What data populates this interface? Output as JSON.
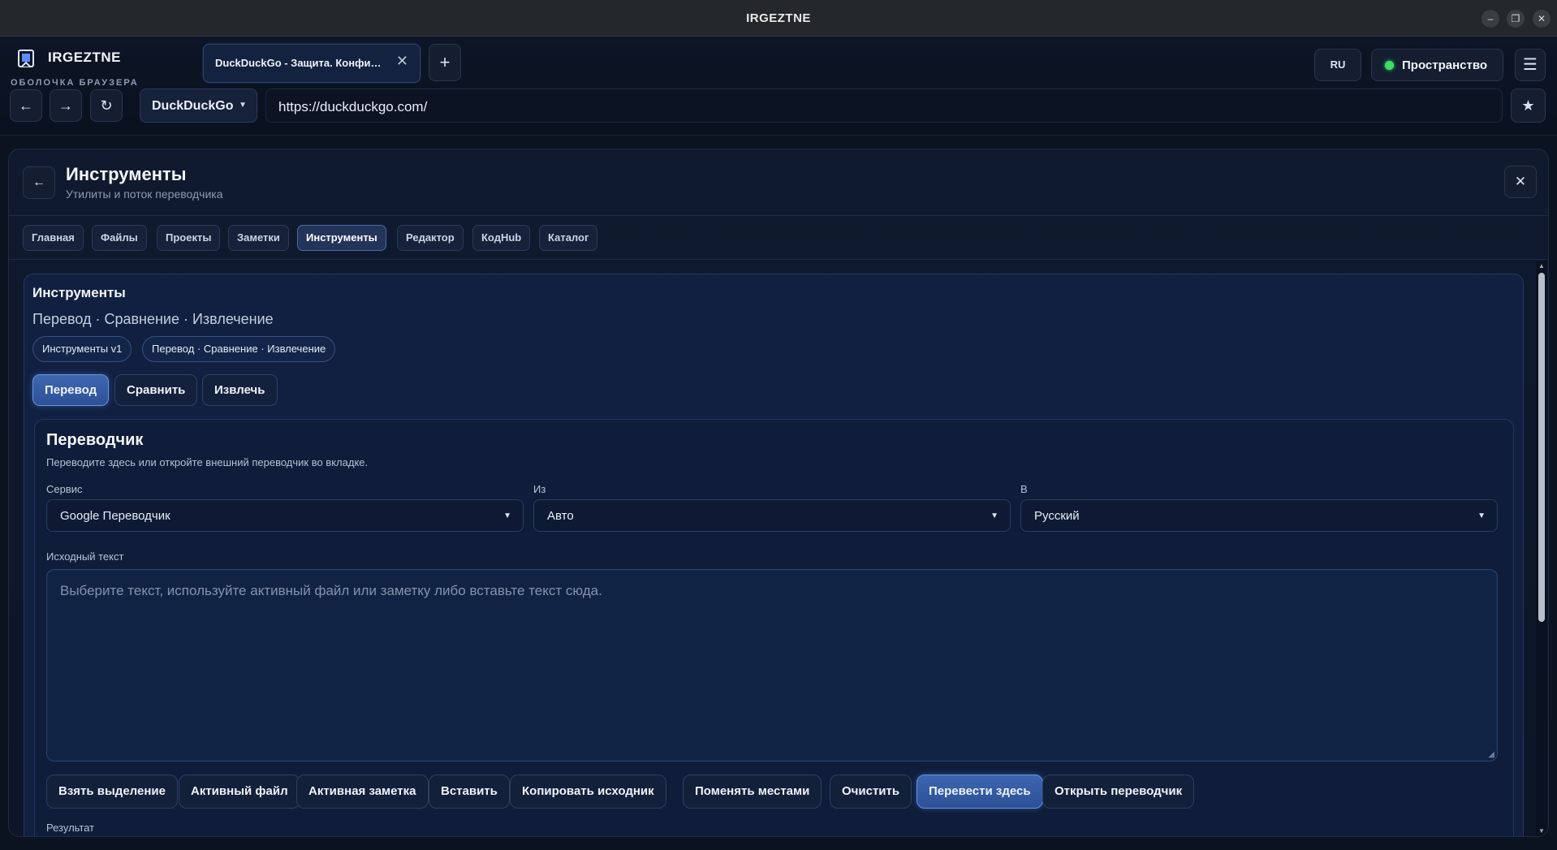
{
  "window": {
    "title": "IRGEZTNE",
    "controls": [
      "–",
      "❐",
      "✕"
    ]
  },
  "brand": {
    "name": "IRGEZTNE",
    "subtitle": "ОБОЛОЧКА БРАУЗЕРА"
  },
  "tabs": [
    {
      "label": "DuckDuckGo - Защита. Конфиденциальность. Мир.",
      "close": "✕"
    }
  ],
  "new_tab": "+",
  "nav": {
    "back": "←",
    "forward": "→",
    "reload": "↻"
  },
  "header_right": {
    "lang": "RU",
    "space_label": "Пространство",
    "space_status_color": "#3ddc6a",
    "menu": "☰"
  },
  "search_engine": {
    "value": "DuckDuckGo",
    "chevron": "▼"
  },
  "address": {
    "url": "https://duckduckgo.com/"
  },
  "bookmark": "★",
  "panel": {
    "back": "←",
    "title": "Инструменты",
    "subtitle": "Утилиты и поток переводчика",
    "close": "✕",
    "tabs": [
      "Главная",
      "Файлы",
      "Проекты",
      "Заметки",
      "Инструменты",
      "Редактор",
      "КодHub",
      "Каталог"
    ],
    "active_tab": "Инструменты"
  },
  "tools": {
    "title": "Инструменты",
    "subtitle": "Перевод · Сравнение · Извлечение",
    "pills": [
      "Инструменты v1",
      "Перевод · Сравнение · Извлечение"
    ],
    "modes": [
      "Перевод",
      "Сравнить",
      "Извлечь"
    ],
    "active_mode": "Перевод"
  },
  "translator": {
    "title": "Переводчик",
    "description": "Переводите здесь или откройте внешний переводчик во вкладке.",
    "service_label": "Сервис",
    "service_value": "Google Переводчик",
    "from_label": "Из",
    "from_value": "Авто",
    "to_label": "В",
    "to_value": "Русский",
    "source_label": "Исходный текст",
    "source_placeholder": "Выберите текст, используйте активный файл или заметку либо вставьте текст сюда.",
    "actions": [
      "Взять выделение",
      "Активный файл",
      "Активная заметка",
      "Вставить",
      "Копировать исходник",
      "Поменять местами",
      "Очистить",
      "Перевести здесь",
      "Открыть переводчик"
    ],
    "primary_action": "Перевести здесь",
    "result_label": "Результат"
  },
  "colors": {
    "accent": "#3e67b0",
    "background": "#0b1220",
    "panel": "#0f1a2e"
  }
}
